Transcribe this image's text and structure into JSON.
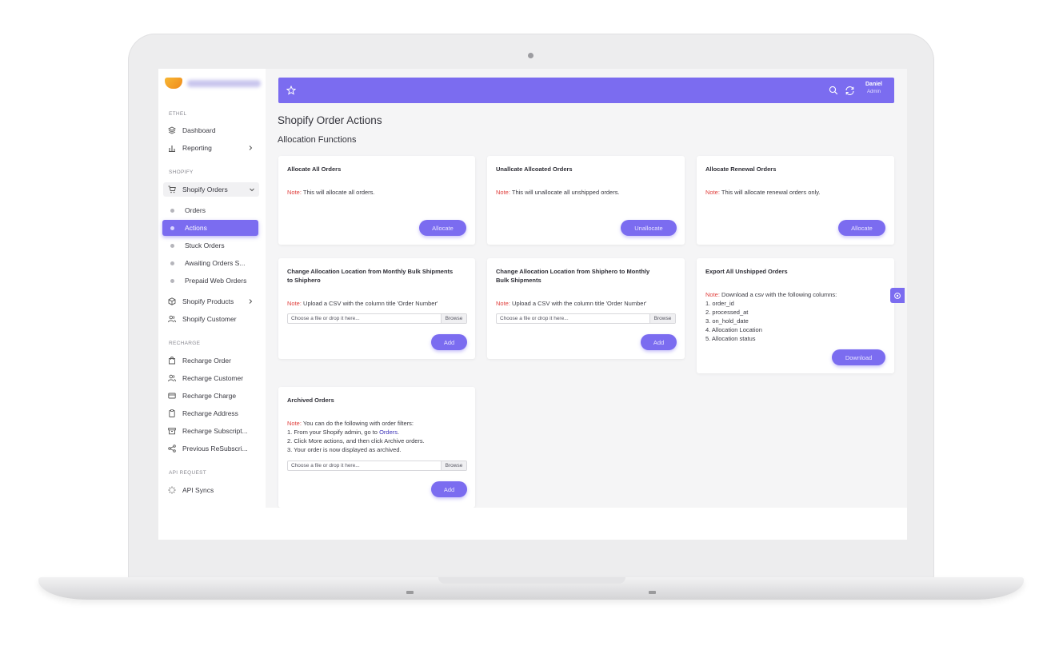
{
  "sidebar": {
    "sections": {
      "ethel": "ETHEL",
      "shopify": "SHOPIFY",
      "recharge": "RECHARGE",
      "api": "API REQUEST"
    },
    "items": {
      "dashboard": "Dashboard",
      "reporting": "Reporting",
      "shopify_orders": "Shopify Orders",
      "orders": "Orders",
      "actions": "Actions",
      "stuck_orders": "Stuck Orders",
      "awaiting_orders": "Awaiting Orders S...",
      "prepaid_web_orders": "Prepaid Web Orders",
      "shopify_products": "Shopify Products",
      "shopify_customer": "Shopify Customer",
      "recharge_order": "Recharge Order",
      "recharge_customer": "Recharge Customer",
      "recharge_charge": "Recharge Charge",
      "recharge_address": "Recharge Address",
      "recharge_subscript": "Recharge Subscript...",
      "previous_resubscri": "Previous ReSubscri...",
      "api_syncs": "API Syncs"
    }
  },
  "header": {
    "user_name": "Daniel",
    "user_role": "Admin"
  },
  "main": {
    "page_title": "Shopify Order Actions",
    "section_title": "Allocation Functions",
    "note_label": "Note:",
    "file_placeholder": "Choose a file or drop it here...",
    "browse_label": "Browse",
    "cards": {
      "allocate_all": {
        "title": "Allocate All Orders",
        "note": " This will allocate all orders.",
        "button": "Allocate"
      },
      "unallocate": {
        "title": "Unallcate Allcoated Orders",
        "note": " This will unallocate all unshipped orders.",
        "button": "Unallocate"
      },
      "allocate_renewal": {
        "title": "Allocate Renewal Orders",
        "note": " This will allocate renewal orders only.",
        "button": "Allocate"
      },
      "change_to_shiphero": {
        "title_line1": "Change Allocation Location from Monthly Bulk Shipments",
        "title_line2": "to Shiphero",
        "note": " Upload a CSV with the column title 'Order Number'",
        "button": "Add"
      },
      "change_to_bulk": {
        "title_line1": "Change Allocation Location from Shiphero to Monthly",
        "title_line2": "Bulk Shipments",
        "note": " Upload a CSV with the column title 'Order Number'",
        "button": "Add"
      },
      "export_unshipped": {
        "title": "Export All Unshipped Orders",
        "note": " Download a csv with the following columns:",
        "columns": [
          "1. order_id",
          "2. processed_at",
          "3. on_hold_date",
          "4. Allocation Location",
          "5. Allocation status"
        ],
        "button": "Download"
      },
      "archived": {
        "title": "Archived Orders",
        "note": " You can do the following with order filters:",
        "step1_prefix": "1. From your Shopify admin, go to ",
        "step1_link": "Orders",
        "step1_suffix": ".",
        "step2": "2. Click More actions, and then click Archive orders.",
        "step3": "3. Your order is now displayed as archived.",
        "button": "Add"
      }
    }
  }
}
